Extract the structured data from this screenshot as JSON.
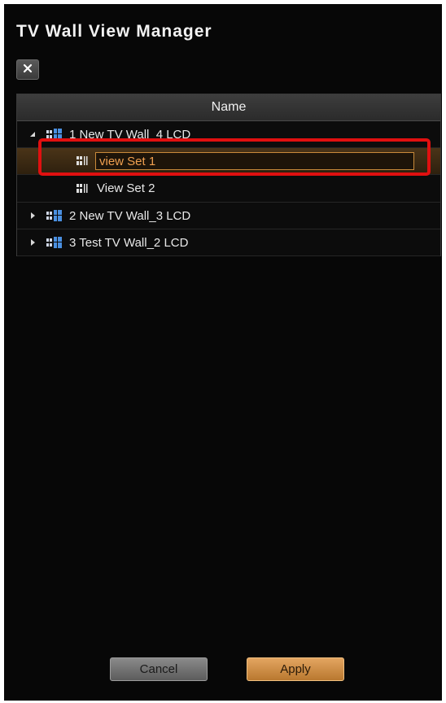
{
  "window": {
    "title": "TV Wall View Manager"
  },
  "toolbar": {
    "close_icon": "close-icon"
  },
  "tree": {
    "column_header": "Name",
    "walls": [
      {
        "label": "1 New TV Wall_4 LCD",
        "expanded": true,
        "icon": "tv-wall-icon",
        "views": [
          {
            "label": "view Set 1",
            "editing": true,
            "selected": true,
            "icon": "view-set-icon"
          },
          {
            "label": "View Set 2",
            "editing": false,
            "selected": false,
            "icon": "view-set-icon"
          }
        ]
      },
      {
        "label": "2 New TV Wall_3 LCD",
        "expanded": false,
        "icon": "tv-wall-icon"
      },
      {
        "label": "3 Test TV Wall_2 LCD",
        "expanded": false,
        "icon": "tv-wall-icon"
      }
    ]
  },
  "buttons": {
    "cancel_label": "Cancel",
    "apply_label": "Apply"
  },
  "colors": {
    "background": "#070707",
    "selected_row": "#3d2a12",
    "edit_text": "#f0a050",
    "highlight_annotation": "#e01010",
    "apply_button": "#d39248",
    "wall_icon": "#4a8fe0"
  }
}
